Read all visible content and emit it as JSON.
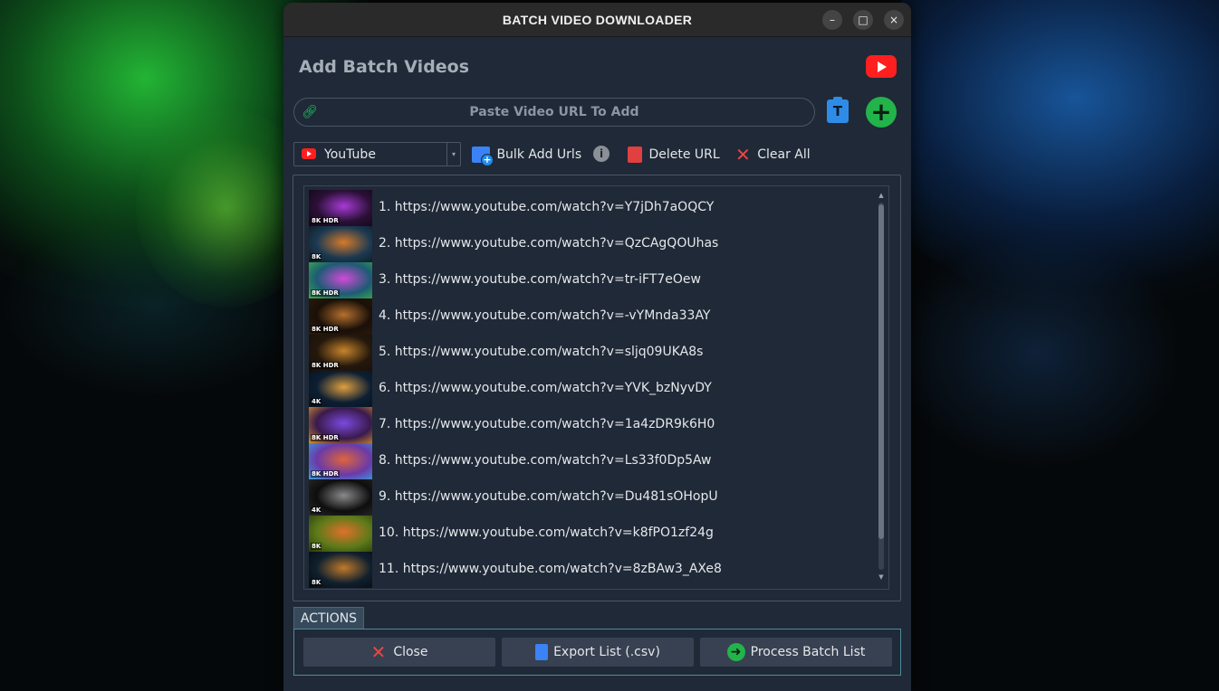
{
  "window": {
    "title": "BATCH VIDEO DOWNLOADER",
    "controls": {
      "minimize": "–",
      "maximize": "□",
      "close": "×"
    }
  },
  "header": {
    "heading": "Add Batch Videos",
    "logo_icon": "youtube-logo-icon"
  },
  "url_bar": {
    "placeholder": "Paste Video URL To Add",
    "link_icon": "link-icon",
    "paste_icon_letter": "T",
    "add_symbol": "+"
  },
  "toolbar": {
    "platform_value": "YouTube",
    "dropdown_arrow": "▾",
    "bulk_label": "Bulk Add Urls",
    "info_symbol": "i",
    "delete_label": "Delete URL",
    "clear_icon": "✕",
    "clear_label": "Clear All"
  },
  "videos": [
    {
      "text": "1. https://www.youtube.com/watch?v=Y7jDh7aOQCY",
      "badge": "8K HDR",
      "thumb_colors": [
        "#2a1036",
        "#a83ad6",
        "#130616"
      ]
    },
    {
      "text": "2. https://www.youtube.com/watch?v=QzCAgQOUhas",
      "badge": "8K",
      "thumb_colors": [
        "#1c3a52",
        "#d77a2a",
        "#0c1820"
      ]
    },
    {
      "text": "3. https://www.youtube.com/watch?v=tr-iFT7eOew",
      "badge": "8K HDR",
      "thumb_colors": [
        "#1d5b74",
        "#d24ad8",
        "#3ab04a"
      ]
    },
    {
      "text": "4. https://www.youtube.com/watch?v=-vYMnda33AY",
      "badge": "8K HDR",
      "thumb_colors": [
        "#1a1008",
        "#b6702e",
        "#2b1a0c"
      ]
    },
    {
      "text": "5. https://www.youtube.com/watch?v=sljq09UKA8s",
      "badge": "8K HDR",
      "thumb_colors": [
        "#24180c",
        "#c8842c",
        "#161008"
      ]
    },
    {
      "text": "6. https://www.youtube.com/watch?v=YVK_bzNyvDY",
      "badge": "4K",
      "thumb_colors": [
        "#0d1f34",
        "#e0a040",
        "#08111c"
      ]
    },
    {
      "text": "7. https://www.youtube.com/watch?v=1a4zDR9k6H0",
      "badge": "8K HDR",
      "thumb_colors": [
        "#3a1a4c",
        "#7a4ae0",
        "#d8902a"
      ]
    },
    {
      "text": "8. https://www.youtube.com/watch?v=Ls33f0Dp5Aw",
      "badge": "8K HDR",
      "thumb_colors": [
        "#6a3aa8",
        "#e0643a",
        "#3aa0e0"
      ]
    },
    {
      "text": "9. https://www.youtube.com/watch?v=Du481sOHopU",
      "badge": "4K",
      "thumb_colors": [
        "#0e0e0e",
        "#8a8a8a",
        "#2a2a2a"
      ]
    },
    {
      "text": "10. https://www.youtube.com/watch?v=k8fPO1zf24g",
      "badge": "8K",
      "thumb_colors": [
        "#5c7a1a",
        "#e0702a",
        "#2a3a0c"
      ]
    },
    {
      "text": "11. https://www.youtube.com/watch?v=8zBAw3_AXe8",
      "badge": "8K",
      "thumb_colors": [
        "#10202e",
        "#c07a2a",
        "#060a10"
      ]
    }
  ],
  "actions": {
    "tab_label": "ACTIONS",
    "close_icon": "✕",
    "close_label": "Close",
    "export_label": "Export List (.csv)",
    "process_icon": "➜",
    "process_label": "Process Batch List"
  },
  "colors": {
    "window_bg": "#1f2937",
    "accent_green": "#22b34b",
    "accent_blue": "#3b82f6",
    "youtube_red": "#ff1f1f",
    "danger_red": "#ef4444"
  }
}
